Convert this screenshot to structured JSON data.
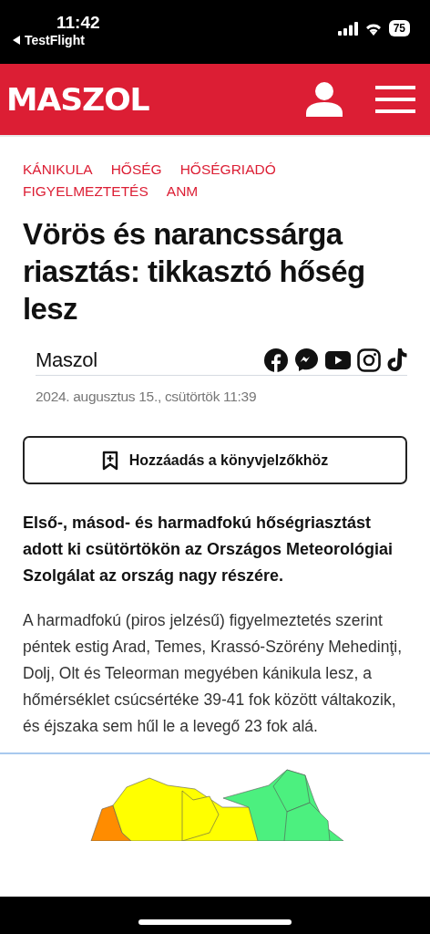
{
  "status_bar": {
    "time": "11:42",
    "back_label": "TestFlight",
    "battery": "75"
  },
  "header": {
    "logo": "MASZOL"
  },
  "tags": [
    "KÁNIKULA",
    "HŐSÉG",
    "HŐSÉGRIADÓ",
    "FIGYELMEZTETÉS",
    "ANM"
  ],
  "title": "Vörös és narancssárga riasztás: tikkasztó hőség lesz",
  "author": "Maszol",
  "date": "2024. augusztus 15., csütörtök 11:39",
  "bookmark_button": "Hozzáadás a könyvjelzőkhöz",
  "lead": "Első-, másod- és harmadfokú hőségriasztást adott ki csütörtökön az Országos Meteorológiai Szolgálat az ország nagy részére.",
  "body": "A harmadfokú (piros jelzésű) figyelmeztetés szerint péntek estig Arad, Temes, Krassó-Szörény Mehedinţi, Dolj, Olt és Teleorman megyében kánikula lesz, a hőmérséklet csúcsértéke 39-41 fok között váltakozik, és éjszaka sem hűl le a levegő 23 fok alá."
}
